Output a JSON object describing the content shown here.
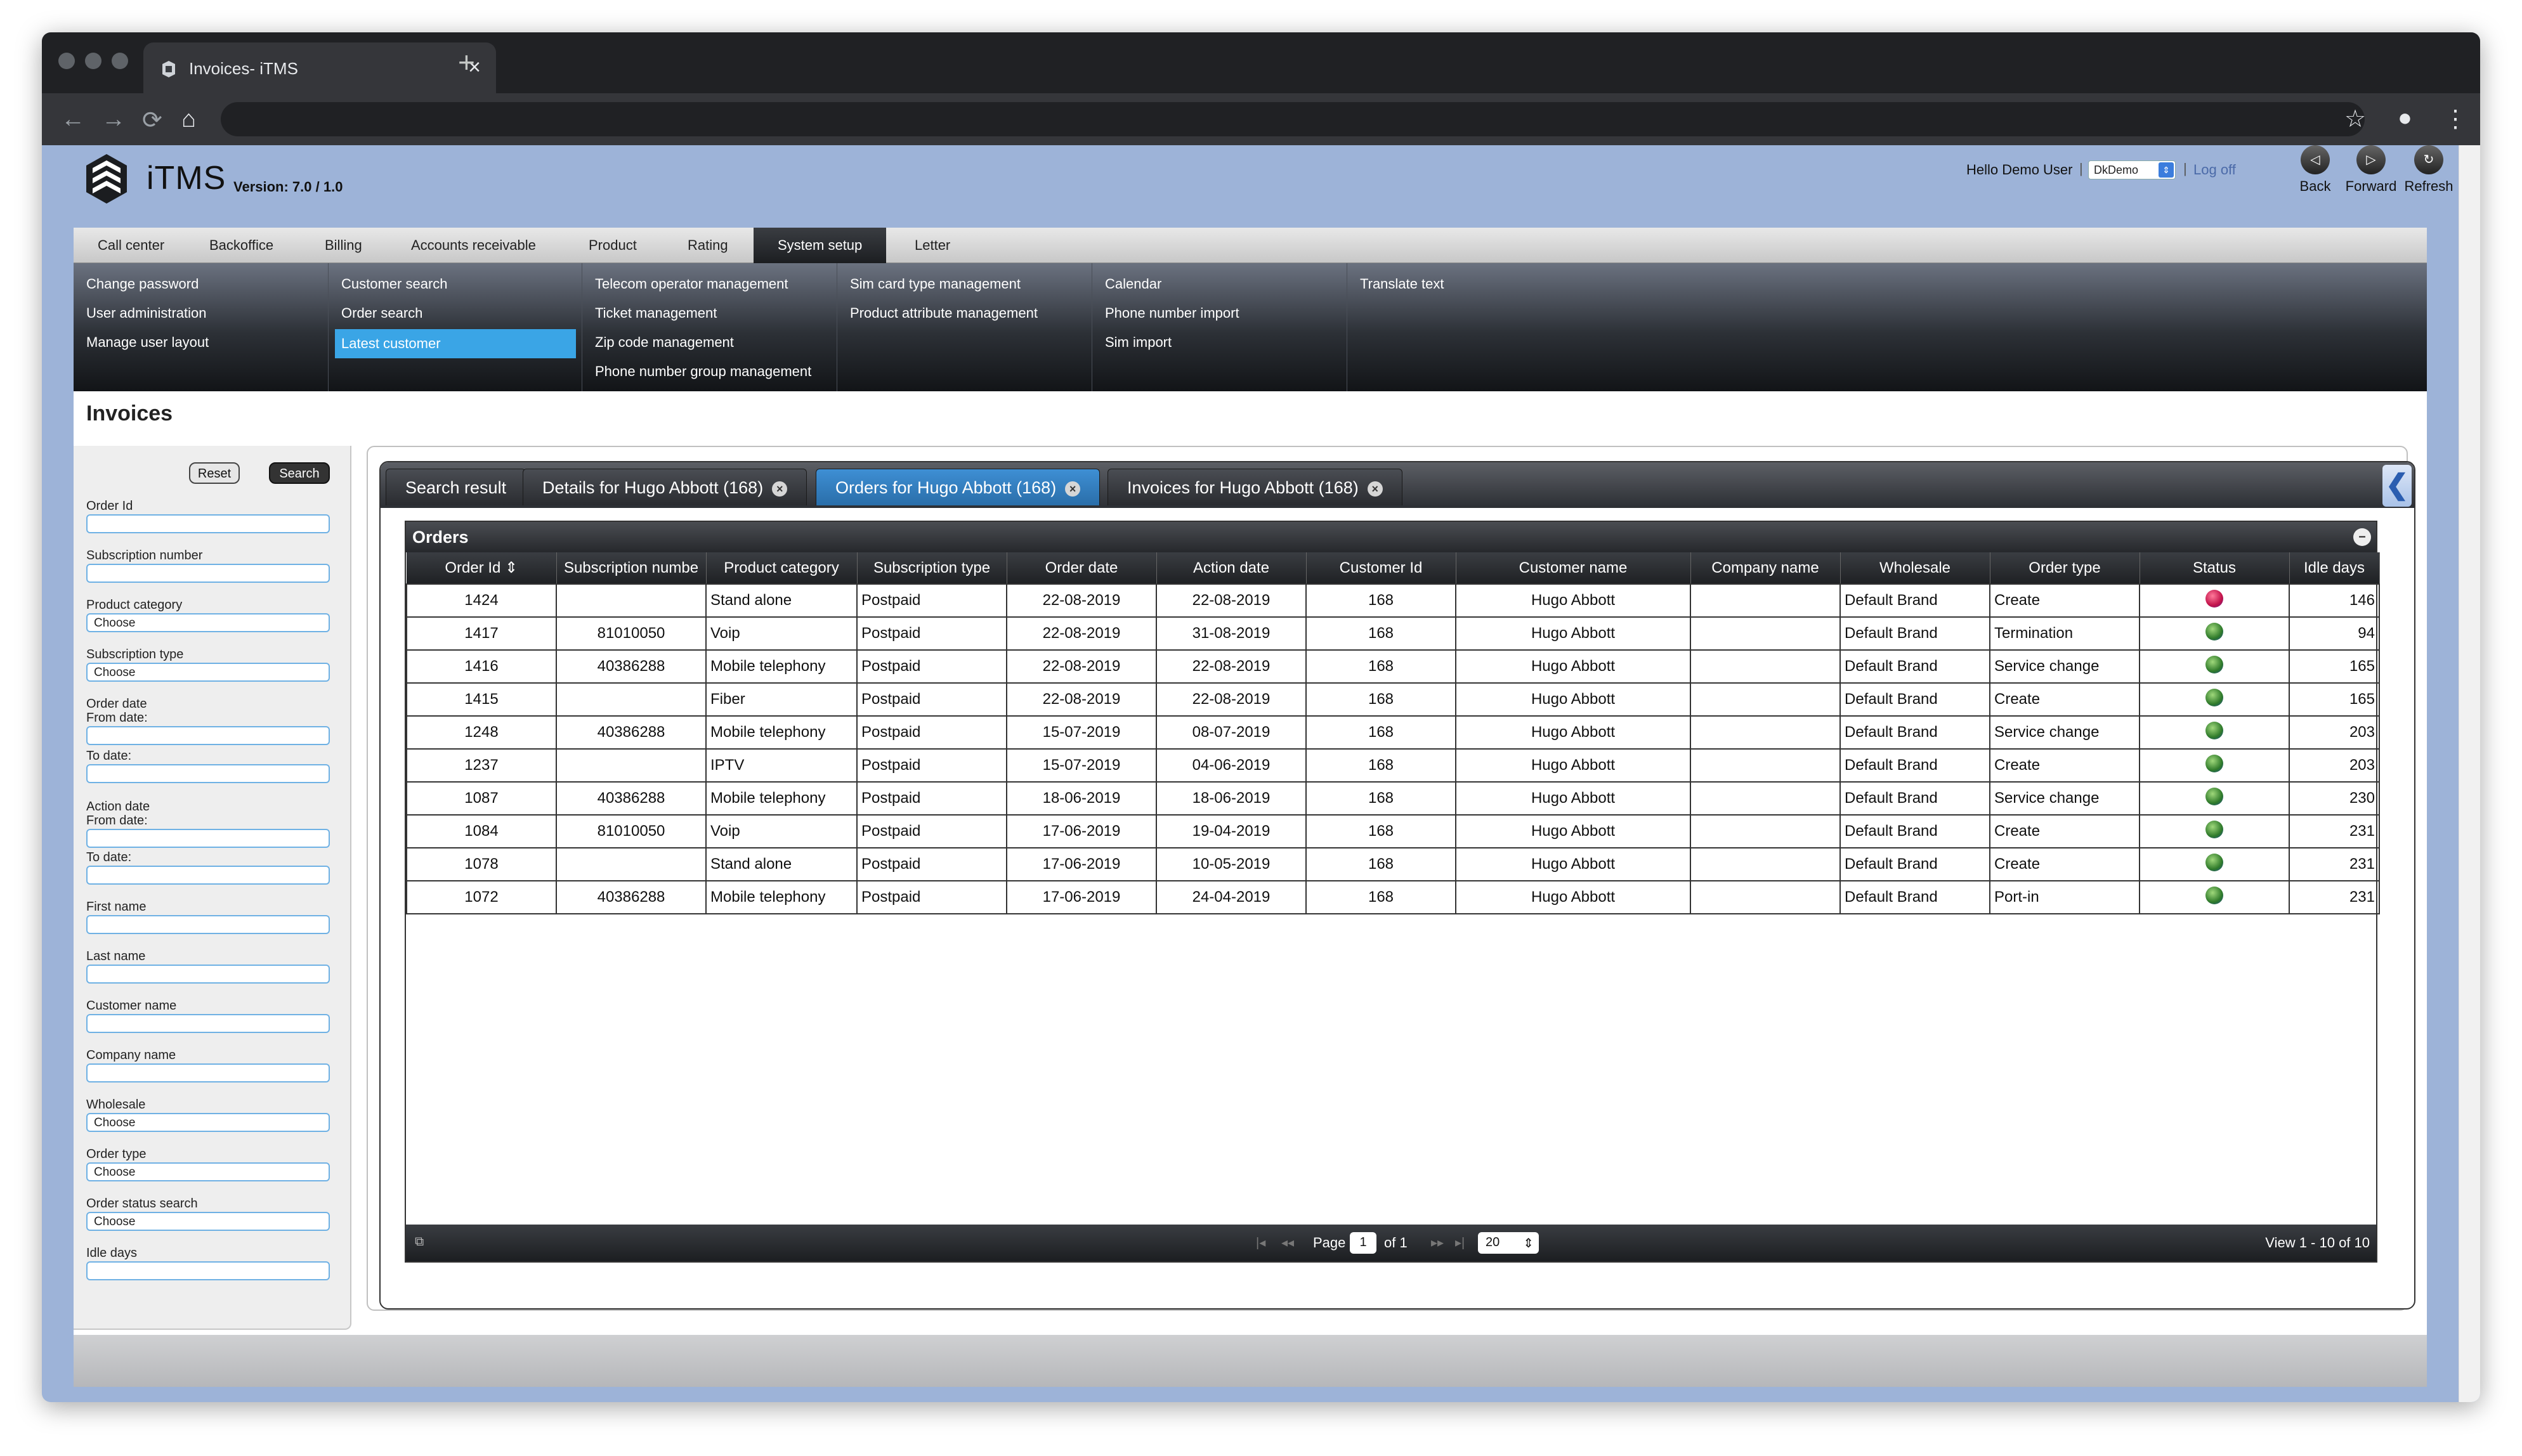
{
  "browser": {
    "tab_title": "Invoices- iTMS",
    "tab_close": "×",
    "new_tab": "+",
    "back": "←",
    "forward": "→",
    "reload": "⟳",
    "home": "⌂",
    "bookmark": "☆",
    "account": "●",
    "menu": "⋮"
  },
  "app": {
    "brand": "iTMS",
    "version": "Version: 7.0 / 1.0",
    "hello": "Hello Demo User",
    "pipe": "|",
    "company_select": "DkDemo",
    "logoff": "Log off",
    "back_label": "Back",
    "forward_label": "Forward",
    "refresh_label": "Refresh",
    "back_icon": "◁",
    "forward_icon": "▷",
    "refresh_icon": "↻"
  },
  "mainnav": [
    {
      "label": "Call center"
    },
    {
      "label": "Backoffice"
    },
    {
      "label": "Billing"
    },
    {
      "label": "Accounts receivable"
    },
    {
      "label": "Product"
    },
    {
      "label": "Rating"
    },
    {
      "label": "System setup",
      "active": true
    },
    {
      "label": "Letter"
    }
  ],
  "submenu": {
    "col1": [
      "Change password",
      "User administration",
      "Manage user layout"
    ],
    "col2": [
      "Customer search",
      "Order search",
      "Latest customer"
    ],
    "col3": [
      "Telecom operator management",
      "Ticket management",
      "Zip code management",
      "Phone number group management"
    ],
    "col4": [
      "Sim card type management",
      "Product attribute management"
    ],
    "col5": [
      "Calendar",
      "Phone number import",
      "Sim import"
    ],
    "col6": [
      "Translate text"
    ]
  },
  "page": {
    "title": "Invoices"
  },
  "filters": {
    "reset": "Reset",
    "search": "Search",
    "order_id": "Order Id",
    "subscription_number": "Subscription number",
    "product_category": "Product category",
    "subscription_type": "Subscription type",
    "order_date": "Order date",
    "from_date": "From date:",
    "to_date": "To date:",
    "action_date": "Action date",
    "first_name": "First name",
    "last_name": "Last name",
    "customer_name": "Customer name",
    "company_name": "Company name",
    "wholesale": "Wholesale",
    "order_type": "Order type",
    "order_status_search": "Order status search",
    "idle_days": "Idle days",
    "choose": "Choose"
  },
  "tabs": [
    {
      "label": "Search result",
      "closable": false
    },
    {
      "label": "Details for Hugo Abbott (168)",
      "closable": true
    },
    {
      "label": "Orders for Hugo Abbott (168)",
      "closable": true,
      "active": true
    },
    {
      "label": "Invoices for Hugo Abbott (168)",
      "closable": true
    }
  ],
  "tab_close_icon": "×",
  "collapse_icon": "❮",
  "grid": {
    "caption": "Orders",
    "minimize_icon": "–",
    "columns": [
      "Order Id ⇕",
      "Subscription numbe",
      "Product category",
      "Subscription type",
      "Order date",
      "Action date",
      "Customer Id",
      "Customer name",
      "Company name",
      "Wholesale",
      "Order type",
      "Status",
      "Idle days"
    ],
    "rows": [
      {
        "order_id": "1424",
        "sub": "",
        "cat": "Stand alone",
        "type": "Postpaid",
        "odate": "22-08-2019",
        "adate": "22-08-2019",
        "cid": "168",
        "cname": "Hugo Abbott",
        "company": "",
        "wholesale": "Default Brand",
        "otype": "Create",
        "status": "red",
        "idle": "146"
      },
      {
        "order_id": "1417",
        "sub": "81010050",
        "cat": "Voip",
        "type": "Postpaid",
        "odate": "22-08-2019",
        "adate": "31-08-2019",
        "cid": "168",
        "cname": "Hugo Abbott",
        "company": "",
        "wholesale": "Default Brand",
        "otype": "Termination",
        "status": "green",
        "idle": "94"
      },
      {
        "order_id": "1416",
        "sub": "40386288",
        "cat": "Mobile telephony",
        "type": "Postpaid",
        "odate": "22-08-2019",
        "adate": "22-08-2019",
        "cid": "168",
        "cname": "Hugo Abbott",
        "company": "",
        "wholesale": "Default Brand",
        "otype": "Service change",
        "status": "green",
        "idle": "165"
      },
      {
        "order_id": "1415",
        "sub": "",
        "cat": "Fiber",
        "type": "Postpaid",
        "odate": "22-08-2019",
        "adate": "22-08-2019",
        "cid": "168",
        "cname": "Hugo Abbott",
        "company": "",
        "wholesale": "Default Brand",
        "otype": "Create",
        "status": "green",
        "idle": "165"
      },
      {
        "order_id": "1248",
        "sub": "40386288",
        "cat": "Mobile telephony",
        "type": "Postpaid",
        "odate": "15-07-2019",
        "adate": "08-07-2019",
        "cid": "168",
        "cname": "Hugo Abbott",
        "company": "",
        "wholesale": "Default Brand",
        "otype": "Service change",
        "status": "green",
        "idle": "203"
      },
      {
        "order_id": "1237",
        "sub": "",
        "cat": "IPTV",
        "type": "Postpaid",
        "odate": "15-07-2019",
        "adate": "04-06-2019",
        "cid": "168",
        "cname": "Hugo Abbott",
        "company": "",
        "wholesale": "Default Brand",
        "otype": "Create",
        "status": "green",
        "idle": "203"
      },
      {
        "order_id": "1087",
        "sub": "40386288",
        "cat": "Mobile telephony",
        "type": "Postpaid",
        "odate": "18-06-2019",
        "adate": "18-06-2019",
        "cid": "168",
        "cname": "Hugo Abbott",
        "company": "",
        "wholesale": "Default Brand",
        "otype": "Service change",
        "status": "green",
        "idle": "230"
      },
      {
        "order_id": "1084",
        "sub": "81010050",
        "cat": "Voip",
        "type": "Postpaid",
        "odate": "17-06-2019",
        "adate": "19-04-2019",
        "cid": "168",
        "cname": "Hugo Abbott",
        "company": "",
        "wholesale": "Default Brand",
        "otype": "Create",
        "status": "green",
        "idle": "231"
      },
      {
        "order_id": "1078",
        "sub": "",
        "cat": "Stand alone",
        "type": "Postpaid",
        "odate": "17-06-2019",
        "adate": "10-05-2019",
        "cid": "168",
        "cname": "Hugo Abbott",
        "company": "",
        "wholesale": "Default Brand",
        "otype": "Create",
        "status": "green",
        "idle": "231"
      },
      {
        "order_id": "1072",
        "sub": "40386288",
        "cat": "Mobile telephony",
        "type": "Postpaid",
        "odate": "17-06-2019",
        "adate": "24-04-2019",
        "cid": "168",
        "cname": "Hugo Abbott",
        "company": "",
        "wholesale": "Default Brand",
        "otype": "Port-in",
        "status": "green",
        "idle": "231"
      }
    ]
  },
  "pager": {
    "page_label": "Page",
    "page_value": "1",
    "of_label": "of 1",
    "rows_per_page": "20",
    "view": "View 1 - 10 of 10",
    "first": "|◂",
    "prev": "◂◂",
    "next": "▸▸",
    "last": "▸|",
    "refresh": "⧉",
    "select_arrow": "⇕"
  },
  "colors": {
    "accent": "#3aa5e6",
    "active_tab": "#3e8fd4",
    "status_ok": "#2f7a2a",
    "status_error": "#c2124a",
    "page_background": "#9db3d8"
  }
}
